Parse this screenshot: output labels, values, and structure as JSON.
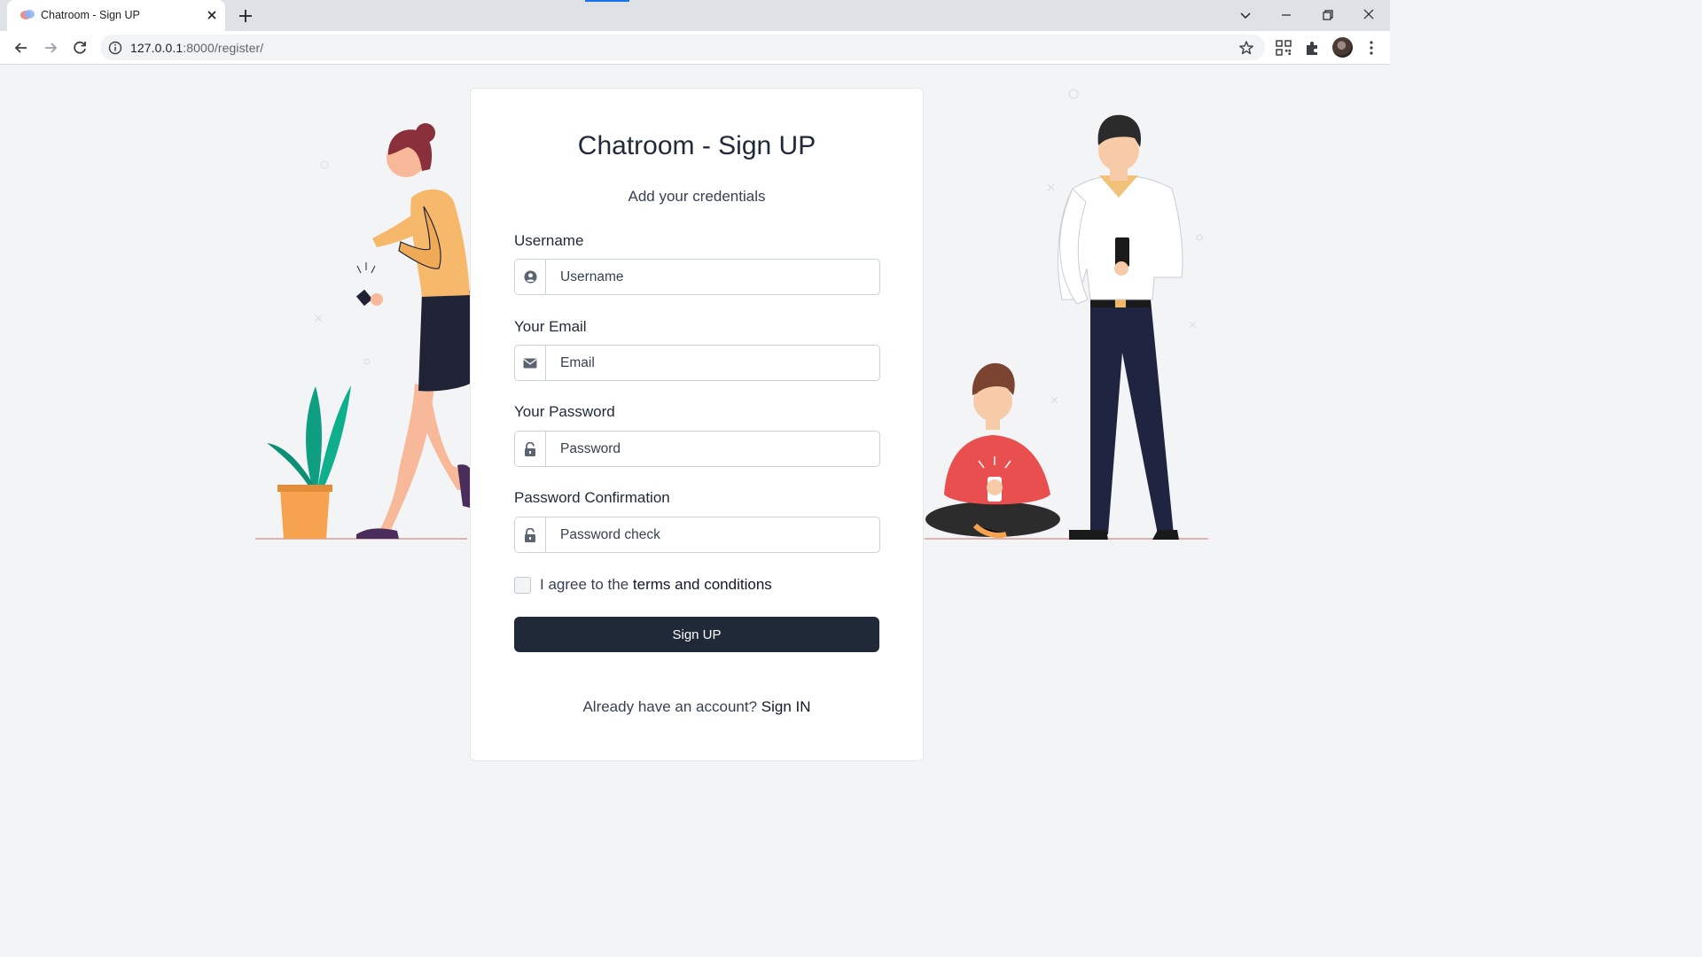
{
  "browser": {
    "tab_title": "Chatroom - Sign UP",
    "url_host": "127.0.0.1",
    "url_rest": ":8000/register/"
  },
  "form": {
    "title": "Chatroom - Sign UP",
    "subtitle": "Add your credentials",
    "username": {
      "label": "Username",
      "placeholder": "Username",
      "icon": "user-circle-icon"
    },
    "email": {
      "label": "Your Email",
      "placeholder": "Email",
      "icon": "envelope-icon"
    },
    "password": {
      "label": "Your Password",
      "placeholder": "Password",
      "icon": "lock-icon"
    },
    "password_confirm": {
      "label": "Password Confirmation",
      "placeholder": "Password check",
      "icon": "lock-icon"
    },
    "agree_prefix": "I agree to the",
    "agree_link": "terms and conditions",
    "submit_label": "Sign UP",
    "footer_text": "Already have an account?",
    "footer_link": "Sign IN"
  },
  "colors": {
    "button": "#1f2937",
    "background": "#f3f4f6",
    "card": "#ffffff"
  }
}
